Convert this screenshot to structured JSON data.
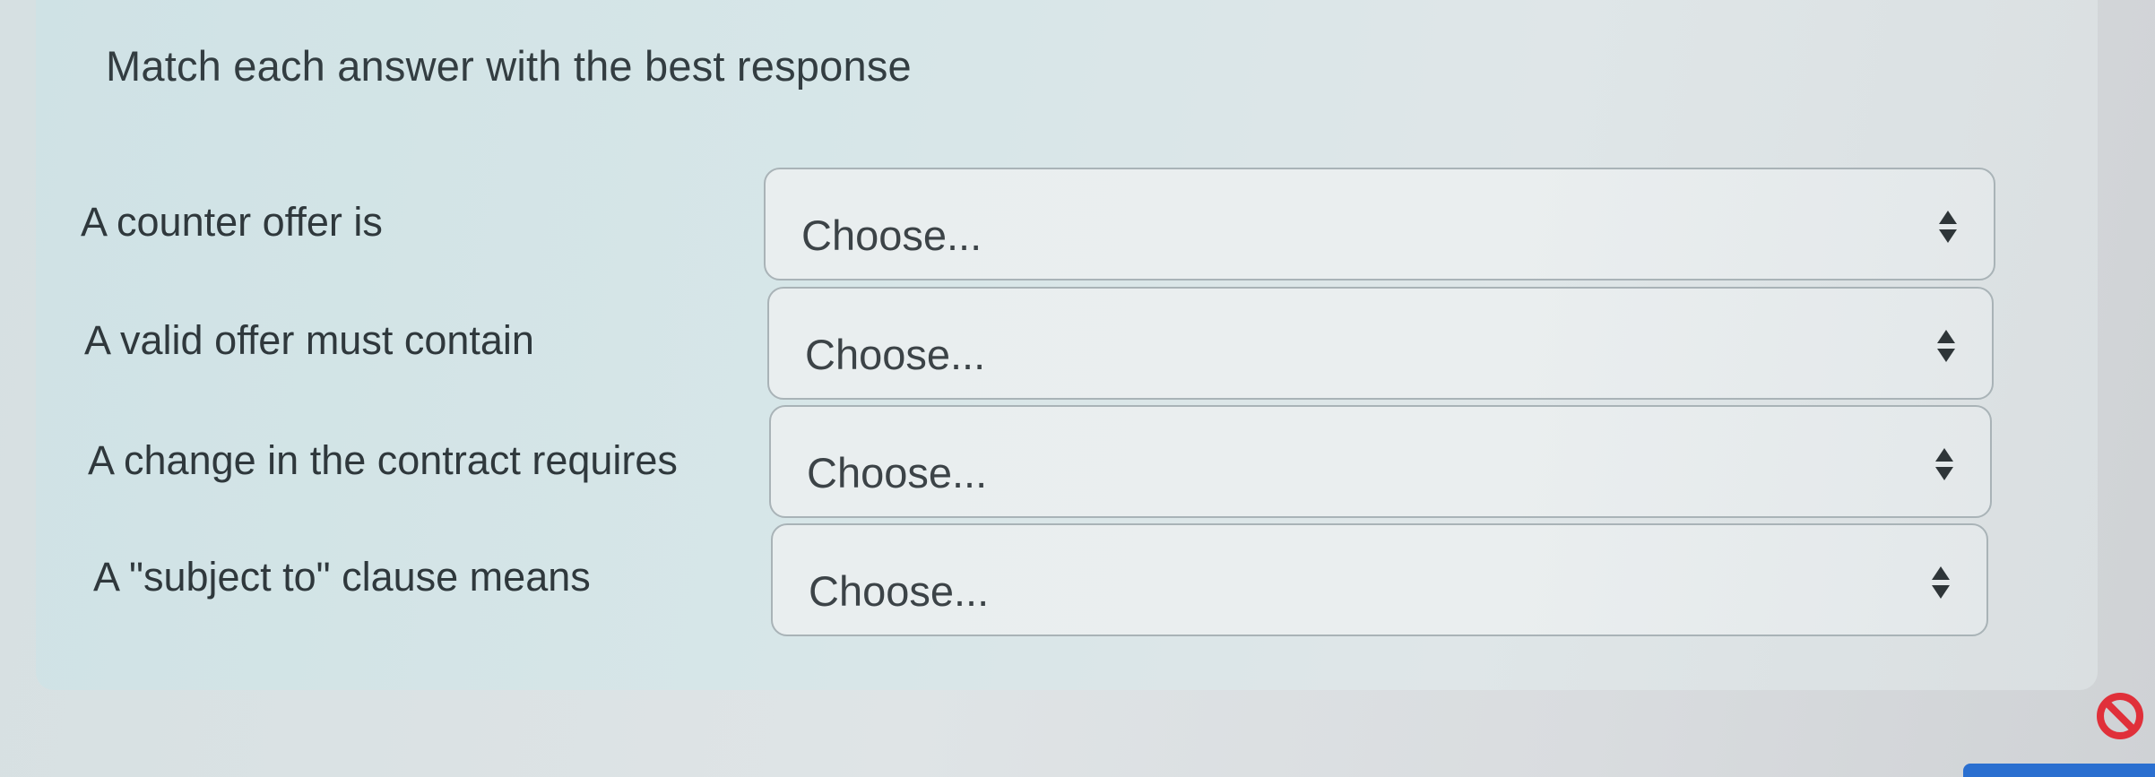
{
  "question": {
    "prompt": "Match each answer with the best response"
  },
  "rows": [
    {
      "label": "A counter offer is",
      "selected": "Choose..."
    },
    {
      "label": "A valid offer must contain",
      "selected": "Choose..."
    },
    {
      "label": "A change in the contract requires",
      "selected": "Choose..."
    },
    {
      "label": "A \"subject to\" clause means",
      "selected": "Choose..."
    }
  ],
  "icons": {
    "select_arrows": "up-down-arrows-icon",
    "status": "no-entry-icon"
  },
  "colors": {
    "status_icon": "#e0303a",
    "accent_button": "#2a6fd0"
  }
}
